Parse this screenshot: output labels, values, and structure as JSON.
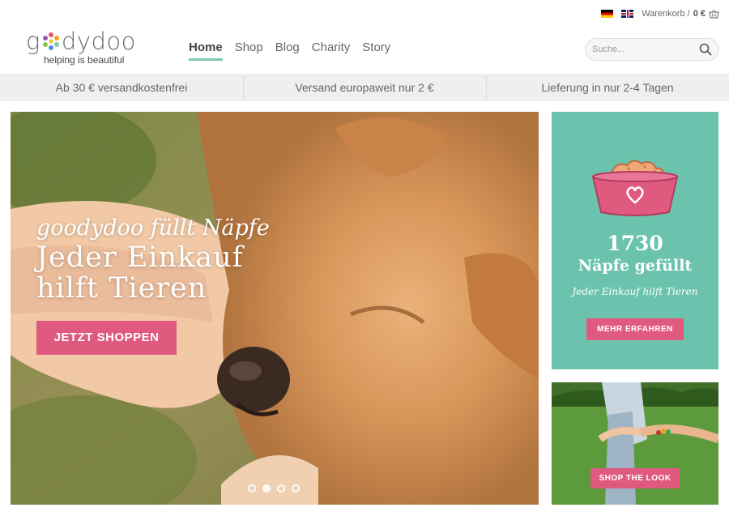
{
  "topbar": {
    "flag_de": "flag-de-icon",
    "flag_uk": "flag-uk-icon",
    "cart_label": "Warenkorb /",
    "cart_total": "0 €",
    "cart_icon": "basket-icon"
  },
  "logo": {
    "word_start": "g",
    "word_end": "dydoo",
    "tagline": "helping is beautiful"
  },
  "nav": {
    "items": [
      {
        "label": "Home",
        "active": true
      },
      {
        "label": "Shop"
      },
      {
        "label": "Blog"
      },
      {
        "label": "Charity"
      },
      {
        "label": "Story"
      }
    ]
  },
  "search": {
    "placeholder": "Suche...",
    "value": "",
    "icon": "search-icon"
  },
  "infobar": {
    "items": [
      "Ab 30 € versandkostenfrei",
      "Versand europaweit nur 2 €",
      "Lieferung in nur 2-4 Tagen"
    ]
  },
  "hero": {
    "script": "goodydoo füllt Näpfe",
    "headline_line1": "Jeder Einkauf",
    "headline_line2": "hilft Tieren",
    "button": "JETZT SHOPPEN",
    "slides_total": 4,
    "slide_active": 2
  },
  "charity_card": {
    "count": "1730",
    "title": "Näpfe gefüllt",
    "script": "Jeder Einkauf hilft Tieren",
    "button": "MEHR ERFAHREN",
    "icon": "food-bowl-heart-icon"
  },
  "look_card": {
    "button": "SHOP THE LOOK"
  },
  "colors": {
    "accent_teal": "#6cc3ad",
    "accent_pink": "#e05a7f",
    "nav_underline": "#7cc8b0"
  }
}
